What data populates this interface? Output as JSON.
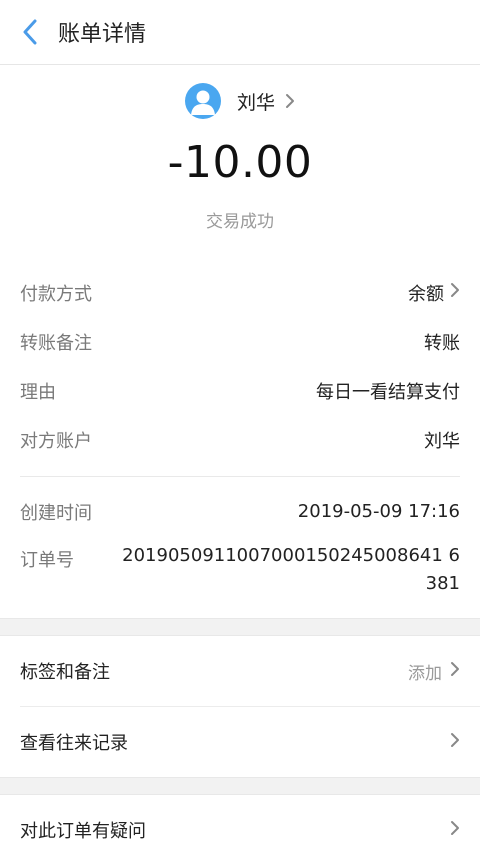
{
  "header": {
    "title": "账单详情",
    "back_icon": "chevron-left-icon",
    "accent": "#4a9be8"
  },
  "payee": {
    "name": "刘华",
    "avatar_color": "#4aa7f0"
  },
  "transaction": {
    "amount": "-10.00",
    "status": "交易成功"
  },
  "details": {
    "payment_method_label": "付款方式",
    "payment_method_value": "余额",
    "transfer_note_label": "转账备注",
    "transfer_note_value": "转账",
    "reason_label": "理由",
    "reason_value": "每日一看结算支付",
    "counterparty_label": "对方账户",
    "counterparty_value": "刘华",
    "created_label": "创建时间",
    "created_value": "2019-05-09 17:16",
    "order_label": "订单号",
    "order_value": "2019050911007000150245008641 6381"
  },
  "actions": {
    "tags_label": "标签和备注",
    "tags_action": "添加",
    "history_label": "查看往来记录",
    "question_label": "对此订单有疑问"
  }
}
